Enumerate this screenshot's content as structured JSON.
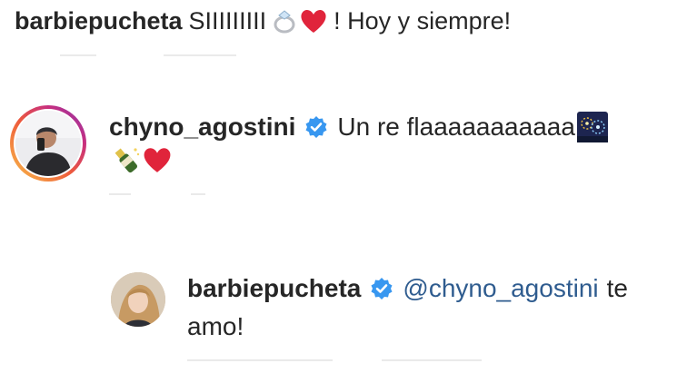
{
  "caption": {
    "username": "barbiepucheta",
    "text_before": "SIIIIIIIII",
    "text_after": "! Hoy y siempre!"
  },
  "comment1": {
    "username": "chyno_agostini",
    "text": "Un re flaaaaaaaaaaa"
  },
  "reply": {
    "username": "barbiepucheta",
    "mention": "@chyno_agostini",
    "text_line1_after": "te",
    "text_line2": "amo!"
  },
  "colors": {
    "verified": "#3897f0",
    "mention": "#2f5c8f",
    "heart": "#e0243b",
    "story_ring": [
      "#f9c14a",
      "#ee5b3b",
      "#c62e80",
      "#833ab4"
    ]
  },
  "icons": [
    "ring-emoji",
    "heart-emoji",
    "fireworks-emoji",
    "champagne-emoji",
    "verified-badge-icon"
  ]
}
